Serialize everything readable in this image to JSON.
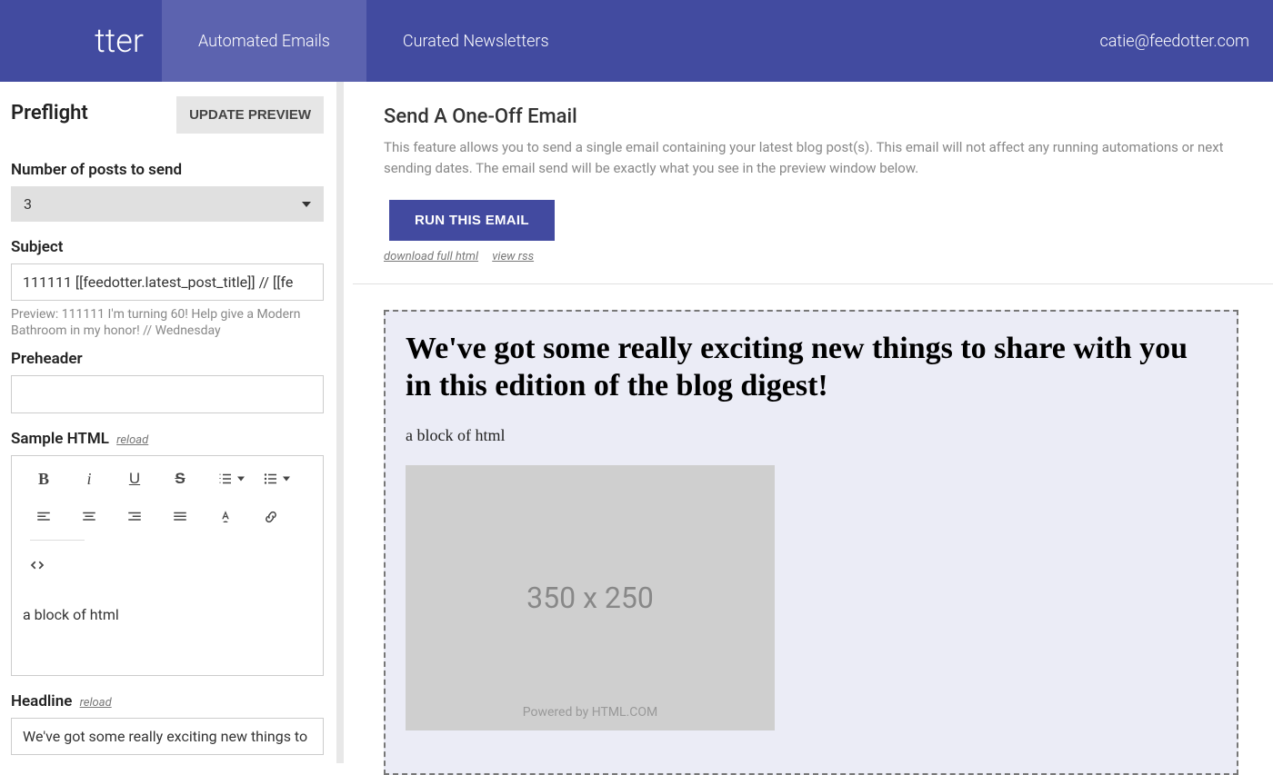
{
  "nav": {
    "logo_fragment": "tter",
    "tabs": [
      {
        "label": "Automated Emails",
        "active": true
      },
      {
        "label": "Curated Newsletters",
        "active": false
      }
    ],
    "user_email": "catie@feedotter.com"
  },
  "sidebar": {
    "title": "Preflight",
    "update_button": "UPDATE PREVIEW",
    "posts_field": {
      "label": "Number of posts to send",
      "selected": "3"
    },
    "subject_field": {
      "label": "Subject",
      "value": "111111 [[feedotter.latest_post_title]] // [[fe",
      "preview_hint": "Preview: 111111 I'm turning 60! Help give a Modern Bathroom in my honor! // Wednesday"
    },
    "preheader_field": {
      "label": "Preheader",
      "value": ""
    },
    "sample_html_field": {
      "label": "Sample HTML",
      "reload_label": "reload",
      "content": "a block of html"
    },
    "headline_field": {
      "label": "Headline",
      "reload_label": "reload",
      "value": "We've got some really exciting new things to"
    }
  },
  "main": {
    "title": "Send A One-Off Email",
    "description": "This feature allows you to send a single email containing your latest blog post(s). This email will not affect any running automations or next sending dates. The email send will be exactly what you see in the preview window below.",
    "run_button": "RUN THIS EMAIL",
    "link_download": "download full html",
    "link_rss": "view rss"
  },
  "preview": {
    "headline": "We've got some really exciting new things to share with you in this edition of the blog digest!",
    "html_sample": "a block of html",
    "placeholder_dim": "350 x 250",
    "placeholder_attr": "Powered by HTML.COM"
  }
}
